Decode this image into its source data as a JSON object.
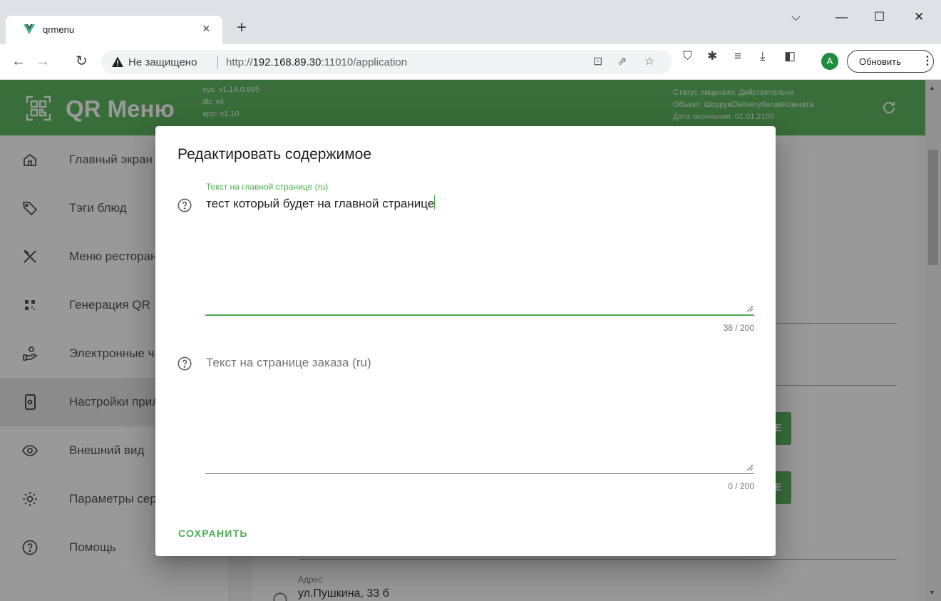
{
  "browser": {
    "tab_title": "qrmenu",
    "tab_close": "×",
    "new_tab": "+",
    "insecure_label": "Не защищено",
    "url_scheme": "http://",
    "url_host": "192.168.89.30",
    "url_rest": ":11010/application",
    "update_label": "Обновить",
    "profile_initial": "A",
    "colors": {
      "tabbar": "#dee1e6",
      "profile": "#1e8e3e"
    }
  },
  "app": {
    "brand": "QR Меню",
    "versions": {
      "sys": "sys: v1.14.0.995",
      "db": "db: v4",
      "app": "app: v1.10"
    },
    "license": {
      "status": "Статус лицензии: Действительна",
      "object": "Объект: ШоурумDeliveryбелаяКомната",
      "expiry": "Дата окончания: 01.01.2100"
    },
    "colors": {
      "primary": "#4caf50"
    }
  },
  "sidebar": {
    "items": [
      {
        "label": "Главный экран",
        "icon": "home-icon"
      },
      {
        "label": "Тэги блюд",
        "icon": "tag-icon"
      },
      {
        "label": "Меню ресторана",
        "icon": "cutlery-icon"
      },
      {
        "label": "Генерация QR",
        "icon": "qr-icon"
      },
      {
        "label": "Электронные чаевые",
        "icon": "hand-user-icon"
      },
      {
        "label": "Настройки приложения",
        "icon": "phone-settings-icon",
        "active": true
      },
      {
        "label": "Внешний вид",
        "icon": "eye-icon"
      },
      {
        "label": "Параметры сервера",
        "icon": "gear-icon"
      },
      {
        "label": "Помощь",
        "icon": "help-icon"
      }
    ]
  },
  "main": {
    "button1_tail": "ОЕ",
    "button2_tail": "ОЕ",
    "address_label": "Адрес",
    "address_value": "ул.Пушкина, 33 б"
  },
  "dialog": {
    "title": "Редактировать содержимое",
    "field1": {
      "label": "Текст на главной странице (ru)",
      "value": "тест который будет на главной странице",
      "counter": "38 / 200"
    },
    "field2": {
      "placeholder": "Текст на странице заказа (ru)",
      "value": "",
      "counter": "0 / 200"
    },
    "save_label": "СОХРАНИТЬ"
  }
}
